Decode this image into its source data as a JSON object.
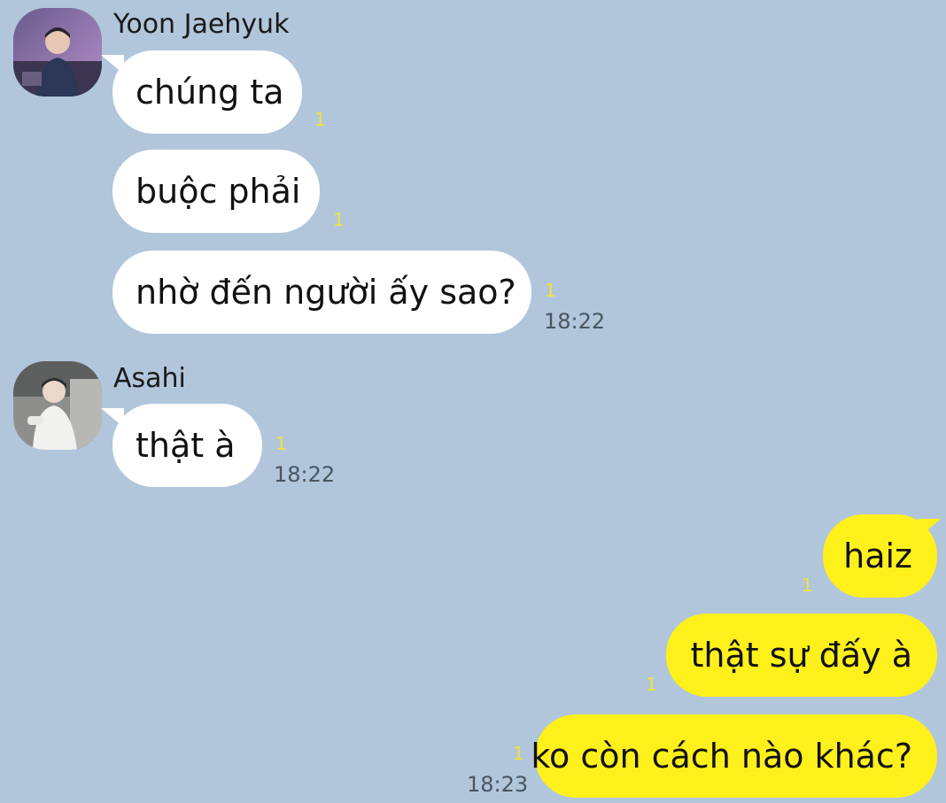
{
  "chat": {
    "groups": [
      {
        "sender": "Yoon Jaehyuk",
        "messages": [
          {
            "text": "chúng ta",
            "read": "1"
          },
          {
            "text": "buộc phải",
            "read": "1"
          },
          {
            "text": "nhờ đến người ấy sao?",
            "read": "1",
            "time": "18:22"
          }
        ]
      },
      {
        "sender": "Asahi",
        "messages": [
          {
            "text": "thật à",
            "read": "1",
            "time": "18:22"
          }
        ]
      },
      {
        "sender": "",
        "messages": [
          {
            "text": "haiz",
            "read": "1"
          },
          {
            "text": "thật sự đấy à",
            "read": "1"
          },
          {
            "text": "ko còn cách nào khác?",
            "read": "1",
            "time": "18:23"
          }
        ]
      }
    ]
  },
  "colors": {
    "background": "#b1c6db",
    "incoming_bubble": "#ffffff",
    "outgoing_bubble": "#fef01b",
    "read_count": "#f2e33a"
  }
}
